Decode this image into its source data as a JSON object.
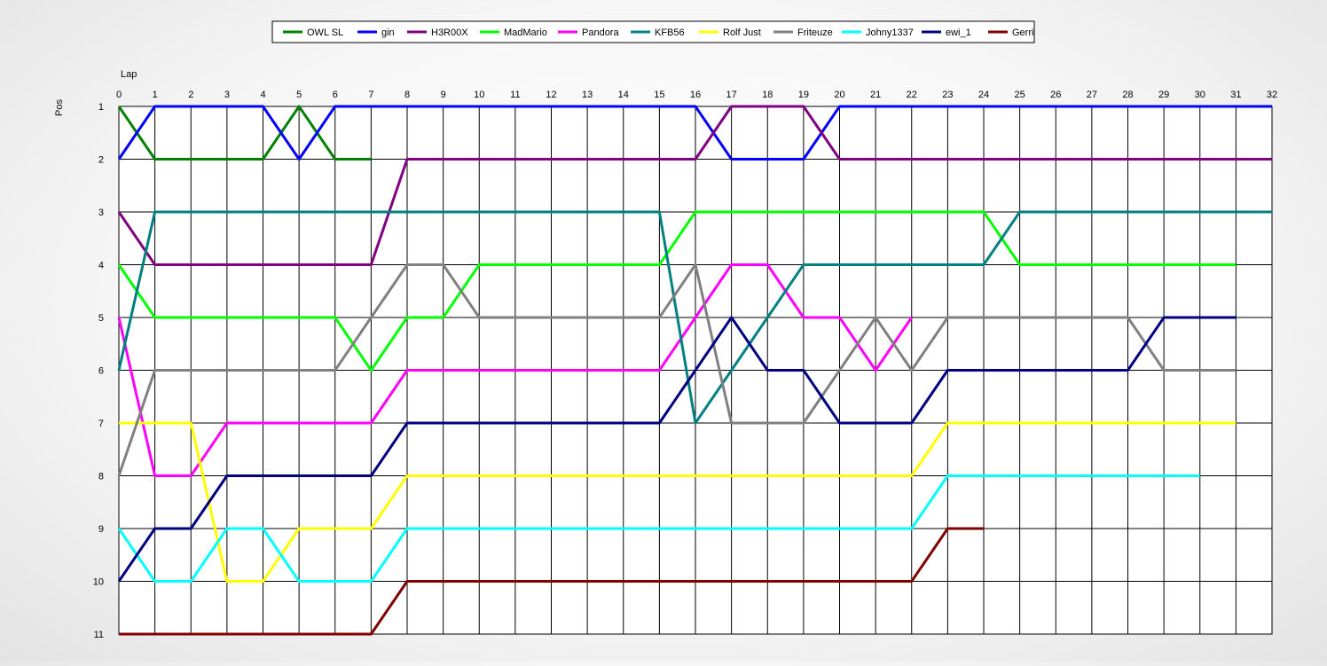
{
  "chart_data": {
    "type": "line",
    "xlabel": "Lap",
    "ylabel": "Pos",
    "x_ticks": [
      0,
      1,
      2,
      3,
      4,
      5,
      6,
      7,
      8,
      9,
      10,
      11,
      12,
      13,
      14,
      15,
      16,
      17,
      18,
      19,
      20,
      21,
      22,
      23,
      24,
      25,
      26,
      27,
      28,
      29,
      30,
      31,
      32
    ],
    "y_ticks": [
      1,
      2,
      3,
      4,
      5,
      6,
      7,
      8,
      9,
      10,
      11
    ],
    "xlim": [
      0,
      32
    ],
    "ylim": [
      1,
      11
    ],
    "y_inverted": true,
    "grid": true,
    "legend_position": "top-center",
    "series": [
      {
        "name": "OWL SL",
        "color": "#008000",
        "start": 0,
        "values": [
          1,
          2,
          2,
          2,
          2,
          1,
          2,
          2
        ]
      },
      {
        "name": "gin",
        "color": "#0000ff",
        "start": 0,
        "values": [
          2,
          1,
          1,
          1,
          1,
          2,
          1,
          1,
          1,
          1,
          1,
          1,
          1,
          1,
          1,
          1,
          1,
          2,
          2,
          2,
          1,
          1,
          1,
          1,
          1,
          1,
          1,
          1,
          1,
          1,
          1,
          1,
          1
        ]
      },
      {
        "name": "H3R00X",
        "color": "#800080",
        "start": 0,
        "values": [
          3,
          4,
          4,
          4,
          4,
          4,
          4,
          4,
          2,
          2,
          2,
          2,
          2,
          2,
          2,
          2,
          2,
          1,
          1,
          1,
          2,
          2,
          2,
          2,
          2,
          2,
          2,
          2,
          2,
          2,
          2,
          2,
          2
        ]
      },
      {
        "name": "MadMario",
        "color": "#00ff00",
        "start": 0,
        "values": [
          4,
          5,
          5,
          5,
          5,
          5,
          5,
          6,
          5,
          5,
          4,
          4,
          4,
          4,
          4,
          4,
          3,
          3,
          3,
          3,
          3,
          3,
          3,
          3,
          3,
          4,
          4,
          4,
          4,
          4,
          4,
          4
        ]
      },
      {
        "name": "Pandora",
        "color": "#ff00ff",
        "start": 0,
        "values": [
          5,
          8,
          8,
          7,
          7,
          7,
          7,
          7,
          6,
          6,
          6,
          6,
          6,
          6,
          6,
          6,
          5,
          4,
          4,
          5,
          5,
          6,
          5
        ]
      },
      {
        "name": "KFB56",
        "color": "#008080",
        "start": 0,
        "values": [
          6,
          3,
          3,
          3,
          3,
          3,
          3,
          3,
          3,
          3,
          3,
          3,
          3,
          3,
          3,
          3,
          7,
          6,
          5,
          4,
          4,
          4,
          4,
          4,
          4,
          3,
          3,
          3,
          3,
          3,
          3,
          3,
          3
        ]
      },
      {
        "name": "Rolf Just",
        "color": "#ffff00",
        "start": 0,
        "values": [
          7,
          7,
          7,
          10,
          10,
          9,
          9,
          9,
          8,
          8,
          8,
          8,
          8,
          8,
          8,
          8,
          8,
          8,
          8,
          8,
          8,
          8,
          8,
          7,
          7,
          7,
          7,
          7,
          7,
          7,
          7,
          7
        ]
      },
      {
        "name": "Friteuze",
        "color": "#808080",
        "start": 0,
        "values": [
          8,
          6,
          6,
          6,
          6,
          6,
          6,
          5,
          4,
          4,
          5,
          5,
          5,
          5,
          5,
          5,
          4,
          7,
          7,
          7,
          6,
          5,
          6,
          5,
          5,
          5,
          5,
          5,
          5,
          6,
          6,
          6
        ]
      },
      {
        "name": "Johny1337",
        "color": "#00ffff",
        "start": 0,
        "values": [
          9,
          10,
          10,
          9,
          9,
          10,
          10,
          10,
          9,
          9,
          9,
          9,
          9,
          9,
          9,
          9,
          9,
          9,
          9,
          9,
          9,
          9,
          9,
          8,
          8,
          8,
          8,
          8,
          8,
          8,
          8
        ]
      },
      {
        "name": "ewi_1",
        "color": "#000080",
        "start": 0,
        "values": [
          10,
          9,
          9,
          8,
          8,
          8,
          8,
          8,
          7,
          7,
          7,
          7,
          7,
          7,
          7,
          7,
          6,
          5,
          6,
          6,
          7,
          7,
          7,
          6,
          6,
          6,
          6,
          6,
          6,
          5,
          5,
          5
        ]
      },
      {
        "name": "Gerri",
        "color": "#800000",
        "start": 0,
        "values": [
          11,
          11,
          11,
          11,
          11,
          11,
          11,
          11,
          10,
          10,
          10,
          10,
          10,
          10,
          10,
          10,
          10,
          10,
          10,
          10,
          10,
          10,
          10,
          9,
          9
        ]
      }
    ]
  }
}
